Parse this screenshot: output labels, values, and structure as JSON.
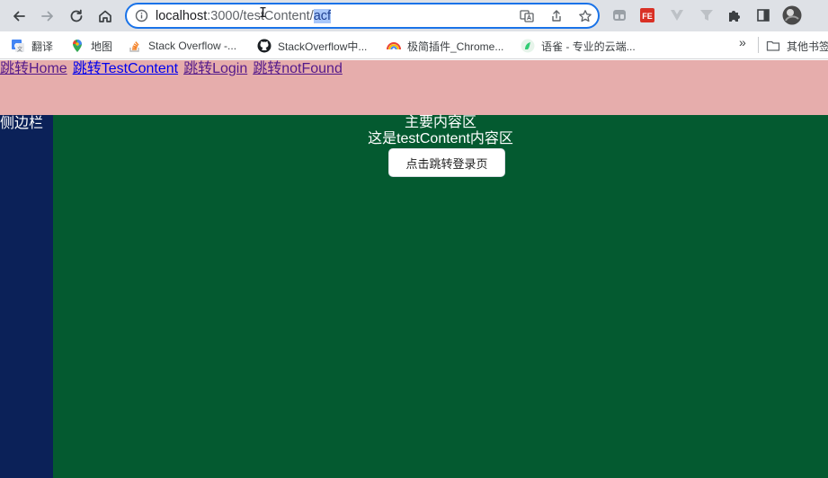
{
  "browser": {
    "url_host": "localhost",
    "url_port_path": ":3000/testContent/",
    "url_selected": "acf",
    "cursor_glyph": "I",
    "icons": [
      "back-arrow-icon",
      "forward-arrow-icon",
      "reload-icon",
      "home-icon",
      "site-info-icon",
      "translate-icon",
      "share-icon",
      "star-icon"
    ],
    "extensions": [
      "extension-window-icon",
      "fe-extension-icon",
      "vue-devtools-icon",
      "filter-extension-icon",
      "puzzle-icon",
      "sidepanel-icon",
      "profile-avatar-icon"
    ],
    "accent_color": "#1a73e8"
  },
  "bookmarks": {
    "items": [
      {
        "label": "翻译",
        "icon": "google-translate-icon"
      },
      {
        "label": "地图",
        "icon": "maps-pin-icon"
      },
      {
        "label": "Stack Overflow -...",
        "icon": "stackoverflow-icon"
      },
      {
        "label": "StackOverflow中...",
        "icon": "github-icon"
      },
      {
        "label": "极简插件_Chrome...",
        "icon": "rainbow-icon"
      },
      {
        "label": "语雀 - 专业的云端...",
        "icon": "yuque-icon"
      }
    ],
    "more": "»",
    "other_folder": "其他书签"
  },
  "header": {
    "background": "#e6adac",
    "links": [
      {
        "label": "跳转Home",
        "state": "visited"
      },
      {
        "label": "跳转TestContent",
        "state": "unvisited"
      },
      {
        "label": "跳转Login",
        "state": "visited"
      },
      {
        "label": "跳转notFound",
        "state": "visited"
      }
    ]
  },
  "sidebar": {
    "title": "侧边栏",
    "background": "#0b2158"
  },
  "main": {
    "title": "主要内容区",
    "subtitle": "这是testContent内容区",
    "button_label": "点击跳转登录页",
    "background": "#045a30"
  }
}
